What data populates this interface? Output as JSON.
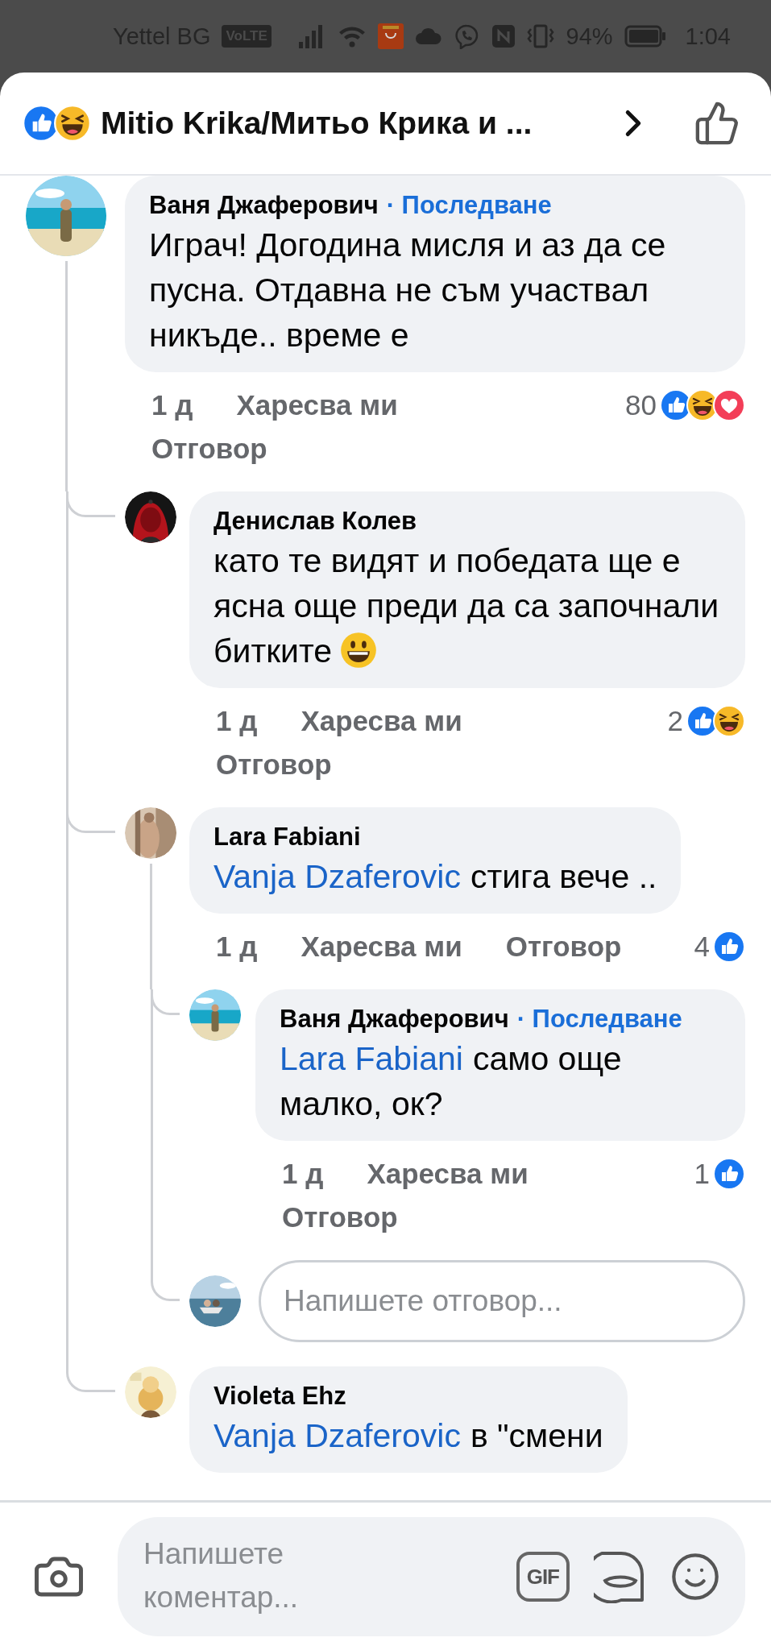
{
  "status_bar": {
    "carrier": "Yettel BG",
    "volte": "VoLTE",
    "battery": "94%",
    "time": "1:04"
  },
  "header": {
    "reactions": [
      {
        "kind": "like"
      },
      {
        "kind": "haha"
      }
    ],
    "title": "Mitio Krika/Митьо Крика и ..."
  },
  "comments": [
    {
      "kind": "comment",
      "author": "Ваня Джаферович",
      "follow": "· Последване",
      "text": "Играч! Догодина мисля и аз да се пусна. Отдавна не съм участвал никъде.. време е",
      "time": "1 д",
      "like": "Харесва ми",
      "reply": "Отговор",
      "reaction_count": "80",
      "reactions": [
        {
          "kind": "like"
        },
        {
          "kind": "haha"
        },
        {
          "kind": "love"
        }
      ],
      "children": [
        {
          "kind": "comment",
          "author": "Денислав Колев",
          "text": "като те видят и победата ще е ясна още преди да са започнали битките",
          "emoji": {
            "kind": "grin"
          },
          "time": "1 д",
          "like": "Харесва ми",
          "reply": "Отговор",
          "reaction_count": "2",
          "reactions": [
            {
              "kind": "like"
            },
            {
              "kind": "haha"
            }
          ]
        },
        {
          "kind": "comment",
          "author": "Lara Fabiani",
          "mention": "Vanja Dzaferovic",
          "text": "стига вече ..",
          "time": "1 д",
          "like": "Харесва ми",
          "reply": "Отговор",
          "reaction_count": "4",
          "reactions": [
            {
              "kind": "like"
            }
          ],
          "children": [
            {
              "kind": "comment",
              "author": "Ваня Джаферович",
              "follow": "· Последване",
              "mention": "Lara Fabiani",
              "text": "само още малко, ок?",
              "time": "1 д",
              "like": "Харесва ми",
              "reply": "Отговор",
              "reaction_count": "1",
              "reactions": [
                {
                  "kind": "like"
                }
              ]
            },
            {
              "kind": "reply_field",
              "placeholder": "Напишете отговор..."
            }
          ]
        },
        {
          "kind": "comment",
          "author": "Violeta Ehz",
          "mention": "Vanja Dzaferovic",
          "text": "в \"смени"
        }
      ]
    }
  ],
  "composer": {
    "placeholder": "Напишете коментар...",
    "gif": "GIF"
  }
}
